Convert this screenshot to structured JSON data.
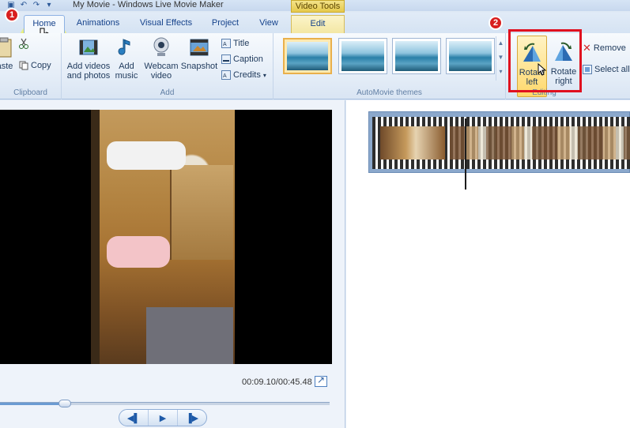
{
  "window": {
    "title": "My Movie - Windows Live Movie Maker",
    "context_group": "Video Tools"
  },
  "tabs": [
    {
      "label": "Home"
    },
    {
      "label": "Animations"
    },
    {
      "label": "Visual Effects"
    },
    {
      "label": "Project"
    },
    {
      "label": "View"
    },
    {
      "label": "Edit"
    }
  ],
  "ribbon": {
    "clipboard": {
      "label": "Clipboard",
      "paste": "aste",
      "copy": "Copy"
    },
    "add": {
      "label": "Add",
      "add_videos": "Add videos\nand photos",
      "add_music": "Add\nmusic",
      "webcam": "Webcam\nvideo",
      "snapshot": "Snapshot",
      "title": "Title",
      "caption": "Caption",
      "credits": "Credits"
    },
    "themes": {
      "label": "AutoMovie themes"
    },
    "editing": {
      "label": "Editing",
      "rotate_left": "Rotate\nleft",
      "rotate_right": "Rotate\nright",
      "remove": "Remove",
      "select_all": "Select all"
    }
  },
  "annotations": {
    "badge1": "1",
    "badge2": "2"
  },
  "preview": {
    "timecode": "00:09.10/00:45.48",
    "progress": 0.2
  },
  "colors": {
    "accent": "#15428b",
    "annotation_red": "#e0101f",
    "highlight_yellow": "#f6f63a"
  }
}
